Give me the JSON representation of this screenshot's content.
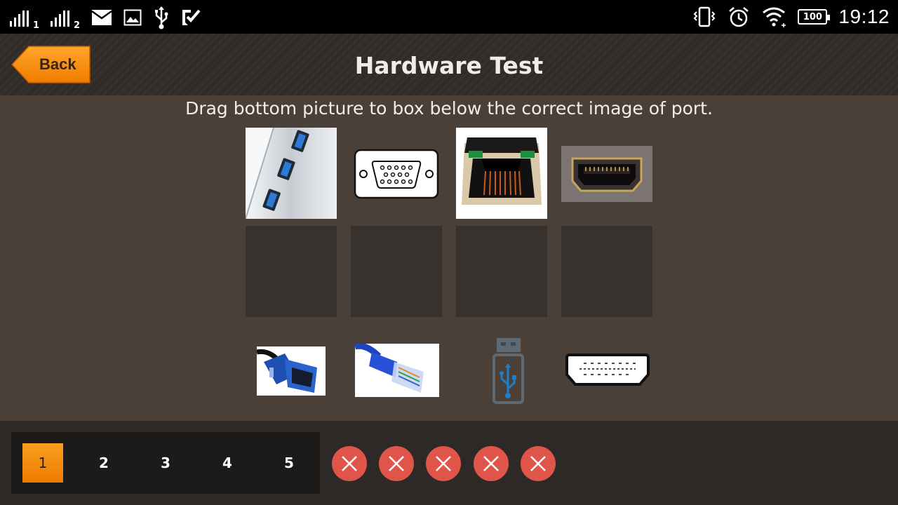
{
  "status_bar": {
    "sim1_label": "1",
    "sim2_label": "2",
    "battery_level": "100",
    "time": "19:12"
  },
  "header": {
    "back_label": "Back",
    "title": "Hardware Test"
  },
  "main": {
    "instruction": "Drag bottom picture to box below the correct image of port.",
    "ports": [
      "usb-port-image",
      "vga-port-image",
      "ethernet-port-image",
      "hdmi-port-image"
    ],
    "cables": [
      "vga-cable-image",
      "ethernet-cable-image",
      "usb-drive-image",
      "hdmi-plug-image"
    ]
  },
  "footer": {
    "pages": [
      "1",
      "2",
      "3",
      "4",
      "5"
    ],
    "active_page": "1",
    "results": [
      "wrong",
      "wrong",
      "wrong",
      "wrong",
      "wrong"
    ],
    "colors": {
      "accent": "#f28a10",
      "wrong": "#e0554a"
    }
  }
}
